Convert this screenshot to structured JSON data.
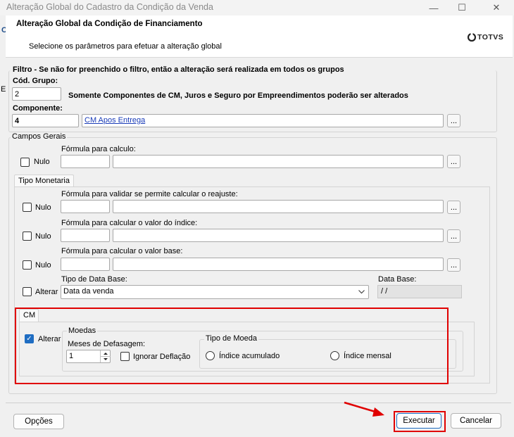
{
  "window": {
    "title": "Alteração Global do Cadastro da Condição da Venda",
    "minimize": "—",
    "maximize": "☐",
    "close": "✕"
  },
  "header": {
    "title": "Alteração Global da Condição de Financiamento",
    "subtitle": "Selecione os parâmetros para efetuar a alteração global",
    "logo_text": "TOTVS",
    "strip_letters": [
      "C",
      "E"
    ]
  },
  "filtro": {
    "heading": "Filtro - Se não for preenchido o filtro, então a alteração será realizada em todos os grupos",
    "cod_grupo_label": "Cód. Grupo:",
    "cod_grupo_value": "2",
    "notice": "Somente Componentes de CM, Juros e Seguro por Empreendimentos poderão ser alterados",
    "componente_label": "Componente:",
    "componente_value": "4",
    "componente_desc": "CM Apos Entrega",
    "ellipsis": "..."
  },
  "campos_gerais": {
    "label": "Campos Gerais",
    "nulo_label": "Nulo",
    "formula_label": "Fórmula para calculo:"
  },
  "tipo_monetaria": {
    "tab_label": "Tipo Monetaria",
    "rows": [
      {
        "nulo": "Nulo",
        "label": "Fórmula para validar se permite calcular o reajuste:"
      },
      {
        "nulo": "Nulo",
        "label": "Fórmula para calcular o valor do índice:"
      },
      {
        "nulo": "Nulo",
        "label": "Fórmula para calcular o valor base:"
      }
    ],
    "alterar_label": "Alterar",
    "tipo_data_base_label": "Tipo de Data Base:",
    "tipo_data_base_value": "Data da venda",
    "data_base_label": "Data Base:",
    "data_base_value": " / /"
  },
  "cm": {
    "tab_label": "CM",
    "alterar_label": "Alterar",
    "moedas_label": "Moedas",
    "meses_label": "Meses de Defasagem:",
    "meses_value": "1",
    "ignorar_label": "Ignorar Deflação",
    "tipo_moeda_label": "Tipo de Moeda",
    "radio_acumulado": "Índice acumulado",
    "radio_mensal": "Índice mensal"
  },
  "footer": {
    "opcoes": "Opções",
    "executar": "Executar",
    "cancelar": "Cancelar"
  },
  "colors": {
    "highlight": "#e00000",
    "link": "#1a3cb8",
    "checked": "#1f6dc2"
  }
}
